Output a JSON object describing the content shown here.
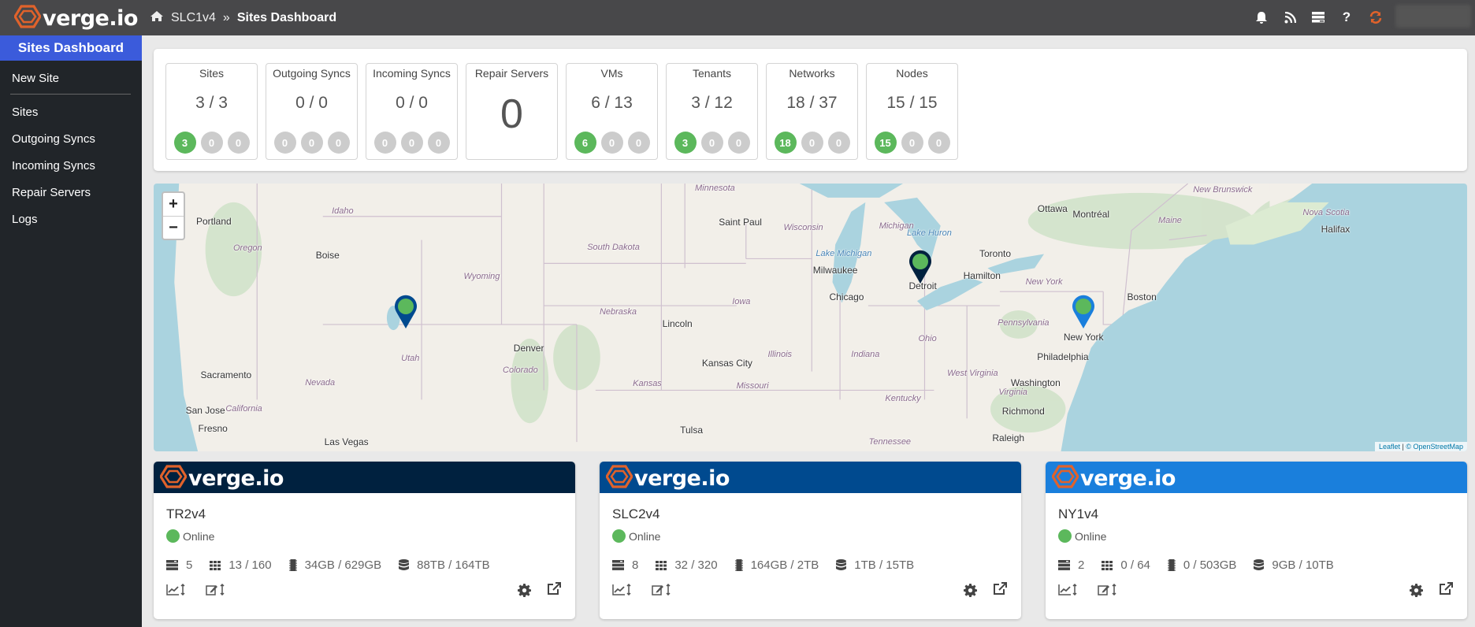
{
  "header": {
    "brand": "verge.io",
    "breadcrumb": [
      "SLC1v4",
      "Sites Dashboard"
    ],
    "icons": [
      "bell-icon",
      "rss-icon",
      "server-list-icon",
      "question-icon",
      "refresh-icon"
    ],
    "accent": "#e0622b"
  },
  "sidebar": {
    "title": "Sites Dashboard",
    "items": [
      {
        "label": "New Site"
      },
      {
        "label": "Sites"
      },
      {
        "label": "Outgoing Syncs"
      },
      {
        "label": "Incoming Syncs"
      },
      {
        "label": "Repair Servers"
      },
      {
        "label": "Logs"
      }
    ]
  },
  "stats": [
    {
      "title": "Sites",
      "value": "3 / 3",
      "badges": [
        "3",
        "0",
        "0"
      ]
    },
    {
      "title": "Outgoing Syncs",
      "value": "0 / 0",
      "badges": [
        "0",
        "0",
        "0"
      ]
    },
    {
      "title": "Incoming Syncs",
      "value": "0 / 0",
      "badges": [
        "0",
        "0",
        "0"
      ]
    },
    {
      "title": "Repair Servers",
      "value": "0"
    },
    {
      "title": "VMs",
      "value": "6 / 13",
      "badges": [
        "6",
        "0",
        "0"
      ]
    },
    {
      "title": "Tenants",
      "value": "3 / 12",
      "badges": [
        "3",
        "0",
        "0"
      ]
    },
    {
      "title": "Networks",
      "value": "18 / 37",
      "badges": [
        "18",
        "0",
        "0"
      ]
    },
    {
      "title": "Nodes",
      "value": "15 / 15",
      "badges": [
        "15",
        "0",
        "0"
      ]
    }
  ],
  "map": {
    "zoom_in": "+",
    "zoom_out": "−",
    "attribution": {
      "leaflet": "Leaflet",
      "osm": "© OpenStreetMap"
    },
    "cities": [
      "Portland",
      "Boise",
      "Sacramento",
      "San Jose",
      "Fresno",
      "Las Vegas",
      "Denver",
      "Lincoln",
      "Kansas City",
      "Tulsa",
      "Saint Paul",
      "Milwaukee",
      "Chicago",
      "Detroit",
      "Toronto",
      "Hamilton",
      "Ottawa",
      "Montréal",
      "Boston",
      "New York",
      "Philadelphia",
      "Washington",
      "Richmond",
      "Raleigh",
      "Halifax"
    ],
    "regions": [
      "Idaho",
      "Oregon",
      "Nevada",
      "California",
      "Utah",
      "Wyoming",
      "Colorado",
      "South Dakota",
      "Nebraska",
      "Kansas",
      "Iowa",
      "Missouri",
      "Minnesota",
      "Wisconsin",
      "Illinois",
      "Indiana",
      "Ohio",
      "Michigan",
      "Kentucky",
      "Tennessee",
      "West Virginia",
      "Virginia",
      "Pennsylvania",
      "New York",
      "Maine",
      "Nova Scotia",
      "New Brunswick"
    ],
    "lakes": [
      "Lake Michigan",
      "Lake Huron"
    ],
    "markers": [
      {
        "site": "SLC2v4",
        "color": "#004a8f"
      },
      {
        "site": "TR2v4",
        "color": "#00213f"
      },
      {
        "site": "NY1v4",
        "color": "#1a7fdc"
      }
    ]
  },
  "sites": [
    {
      "name": "TR2v4",
      "header_color": "#00213f",
      "status": "Online",
      "nodes": "5",
      "cores": "13 / 160",
      "ram": "34GB / 629GB",
      "storage": "88TB / 164TB"
    },
    {
      "name": "SLC2v4",
      "header_color": "#004a8f",
      "status": "Online",
      "nodes": "8",
      "cores": "32 / 320",
      "ram": "164GB / 2TB",
      "storage": "1TB / 15TB"
    },
    {
      "name": "NY1v4",
      "header_color": "#1a7fdc",
      "status": "Online",
      "nodes": "2",
      "cores": "0 / 64",
      "ram": "0 / 503GB",
      "storage": "9GB / 10TB"
    }
  ]
}
